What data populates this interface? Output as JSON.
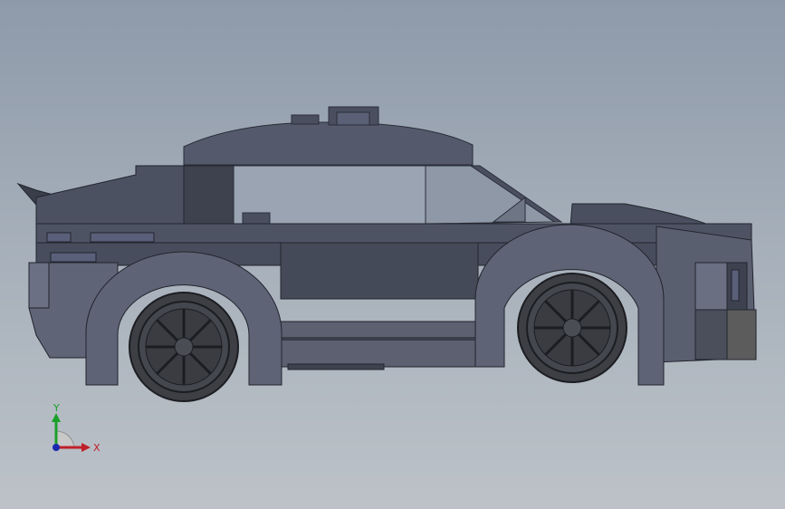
{
  "viewport": {
    "model_icon": "lego-car-model"
  },
  "triad": {
    "x_label": "X",
    "y_label": "Y",
    "colors": {
      "x": "#c0202a",
      "y": "#1aa02a",
      "z": "#1a2ab0"
    }
  }
}
